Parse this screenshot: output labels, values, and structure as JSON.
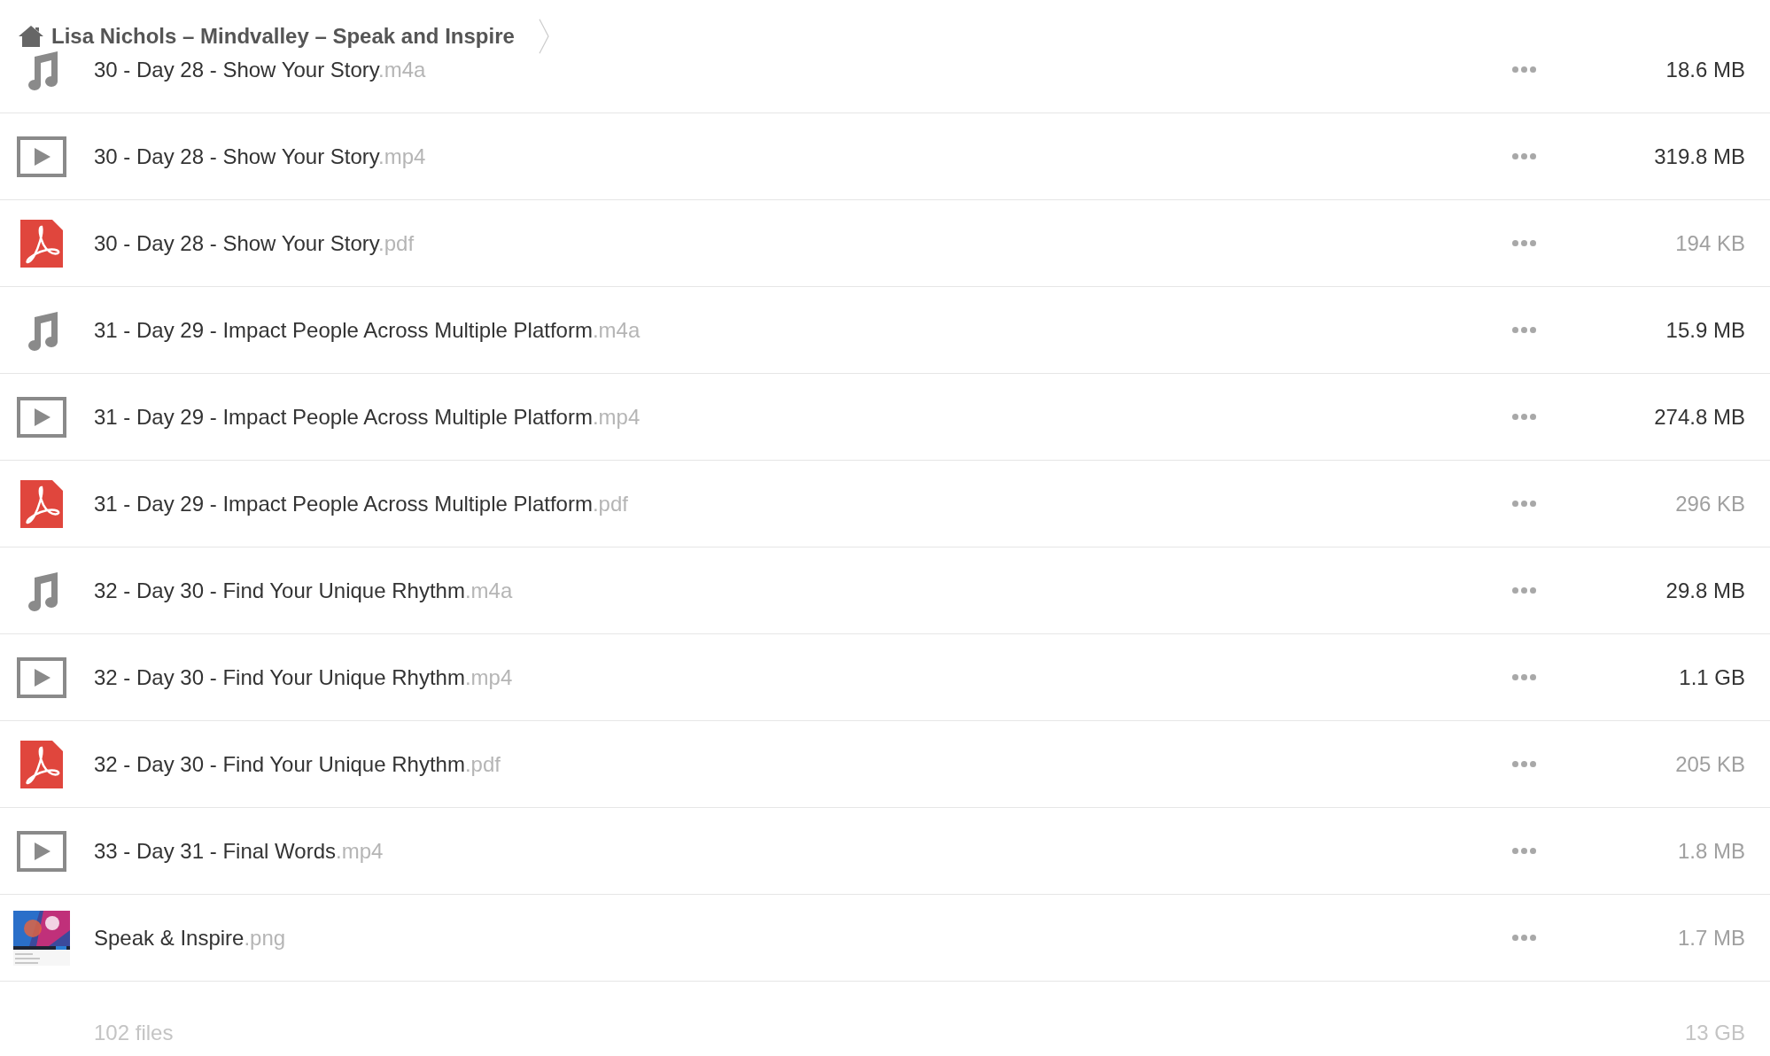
{
  "breadcrumb": {
    "title": "Lisa Nichols – Mindvalley – Speak and Inspire"
  },
  "files": [
    {
      "kind": "audio",
      "name": "30 - Day 28 - Show Your Story",
      "ext": ".m4a",
      "size": "18.6 MB",
      "faded": false
    },
    {
      "kind": "video",
      "name": "30 - Day 28 - Show Your Story",
      "ext": ".mp4",
      "size": "319.8 MB",
      "faded": false
    },
    {
      "kind": "pdf",
      "name": "30 - Day 28 - Show Your Story",
      "ext": ".pdf",
      "size": "194 KB",
      "faded": true
    },
    {
      "kind": "audio",
      "name": "31 - Day 29 - Impact People Across Multiple Platform",
      "ext": ".m4a",
      "size": "15.9 MB",
      "faded": false
    },
    {
      "kind": "video",
      "name": "31 - Day 29 - Impact People Across Multiple Platform",
      "ext": ".mp4",
      "size": "274.8 MB",
      "faded": false
    },
    {
      "kind": "pdf",
      "name": "31 - Day 29 - Impact People Across Multiple Platform",
      "ext": ".pdf",
      "size": "296 KB",
      "faded": true
    },
    {
      "kind": "audio",
      "name": "32 - Day 30 - Find Your Unique Rhythm",
      "ext": ".m4a",
      "size": "29.8 MB",
      "faded": false
    },
    {
      "kind": "video",
      "name": "32 - Day 30 - Find Your Unique Rhythm",
      "ext": ".mp4",
      "size": "1.1 GB",
      "faded": false
    },
    {
      "kind": "pdf",
      "name": "32 - Day 30 - Find Your Unique Rhythm",
      "ext": ".pdf",
      "size": "205 KB",
      "faded": true
    },
    {
      "kind": "video",
      "name": "33 - Day 31 - Final Words",
      "ext": ".mp4",
      "size": "1.8 MB",
      "faded": true
    },
    {
      "name": "Speak & Inspire",
      "ext": ".png",
      "size": "1.7 MB",
      "faded": true
    }
  ],
  "footer": {
    "count": "102 files",
    "total": "13 GB"
  }
}
